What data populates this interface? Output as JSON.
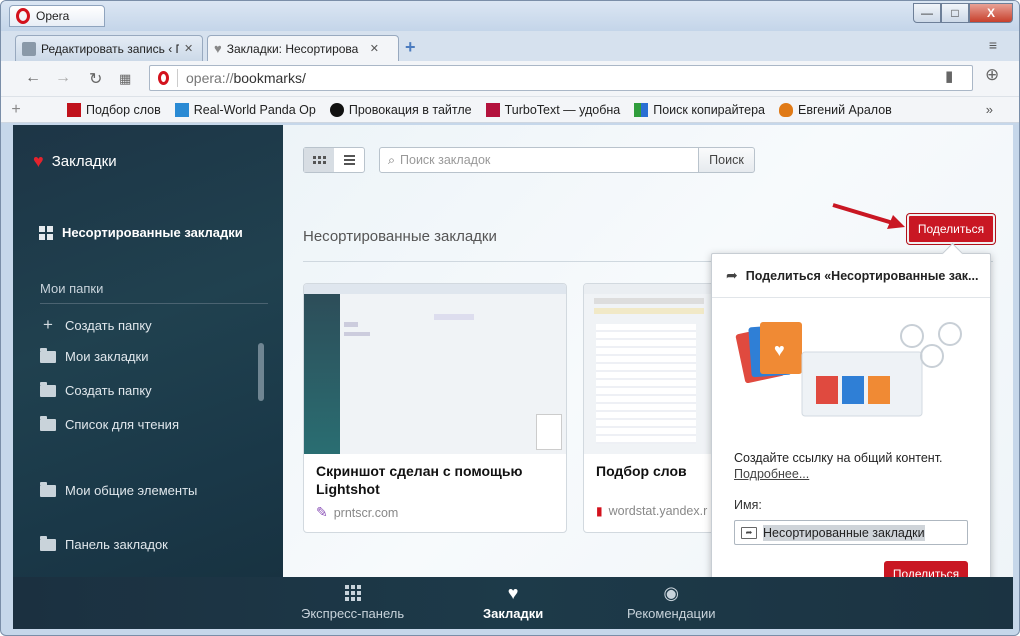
{
  "window": {
    "app_name": "Opera",
    "controls": {
      "minimize": "—",
      "maximize": "□",
      "close": "X"
    }
  },
  "tabs": [
    {
      "title": "Редактировать запись ‹ П",
      "active": false
    },
    {
      "title": "Закладки: Несортирова",
      "active": true
    }
  ],
  "tab_strip": {
    "new_tab": "+",
    "menu": "≡"
  },
  "address_bar": {
    "scheme": "opera://",
    "path": "bookmarks/"
  },
  "bookmarks_bar": {
    "add": "+",
    "more": "»",
    "items": [
      {
        "label": "Подбор слов",
        "icon_color": "#c0121c"
      },
      {
        "label": "Real-World Panda Op",
        "icon_color": "#2a8ad4"
      },
      {
        "label": "Провокация в тайтле",
        "icon_color": "#111111"
      },
      {
        "label": "TurboText — удобна",
        "icon_color": "#b3123d"
      },
      {
        "label": "Поиск копирайтера",
        "icon_color": "#2f9d3c"
      },
      {
        "label": "Евгений Аралов",
        "icon_color": "#e07a17"
      }
    ]
  },
  "sidebar": {
    "title": "Закладки",
    "unsorted": "Несортированные закладки",
    "section": "Мои папки",
    "items": [
      {
        "label": "Создать папку",
        "icon": "plus-icon"
      },
      {
        "label": "Мои закладки",
        "icon": "folder-icon"
      },
      {
        "label": "Создать папку",
        "icon": "folder-icon"
      },
      {
        "label": "Список для чтения",
        "icon": "folder-icon"
      },
      {
        "label": "Мои общие элементы",
        "icon": "folder-icon"
      },
      {
        "label": "Панель закладок",
        "icon": "folder-icon"
      }
    ]
  },
  "main": {
    "search_placeholder": "Поиск закладок",
    "search_button": "Поиск",
    "heading": "Несортированные закладки",
    "share_button": "Поделиться",
    "cards": [
      {
        "title": "Скриншот сделан с помощью Lightshot",
        "url": "prntscr.com"
      },
      {
        "title": "Подбор слов",
        "url": "wordstat.yandex.r"
      }
    ]
  },
  "popup": {
    "title": "Поделиться «Несортированные зак...",
    "description": "Создайте ссылку на общий контент.",
    "more_link": "Подробнее...",
    "name_label": "Имя:",
    "name_value": "Несортированные закладки",
    "share_button": "Поделиться"
  },
  "bottom_nav": [
    {
      "label": "Экспресс-панель",
      "icon": "speed-dial-icon",
      "active": false
    },
    {
      "label": "Закладки",
      "icon": "heart-icon",
      "active": true
    },
    {
      "label": "Рекомендации",
      "icon": "eye-icon",
      "active": false
    }
  ],
  "colors": {
    "accent_red": "#c91723",
    "sidebar_bg": "#1d3a49"
  }
}
